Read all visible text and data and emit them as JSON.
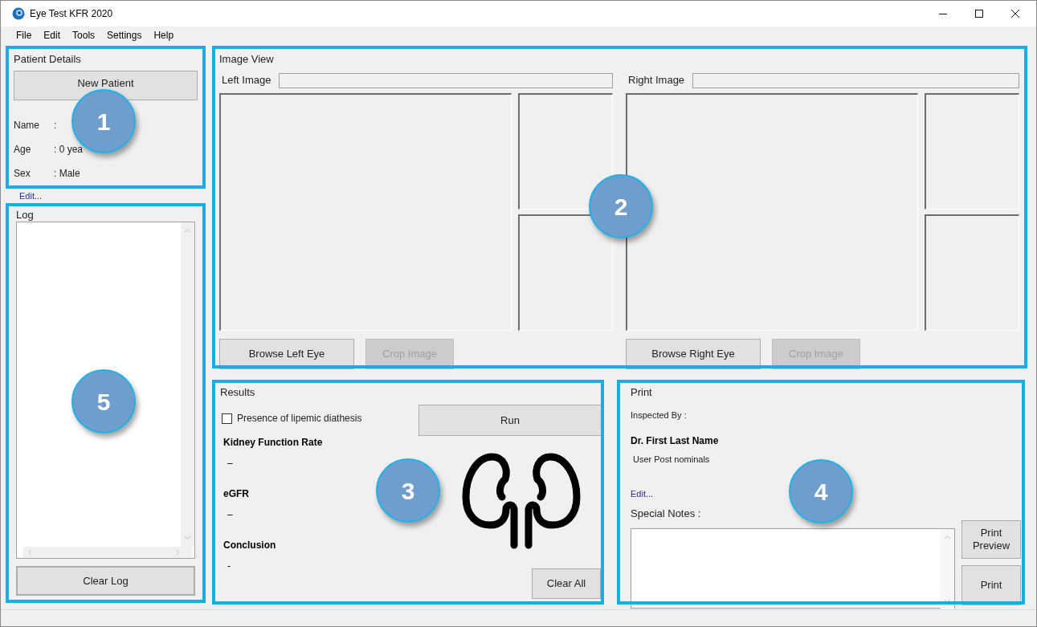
{
  "window": {
    "title": "Eye Test KFR 2020"
  },
  "menu": [
    "File",
    "Edit",
    "Tools",
    "Settings",
    "Help"
  ],
  "patient_details": {
    "title": "Patient Details",
    "callout": "1",
    "new_patient_button": "New Patient",
    "fields": [
      {
        "label": "Name",
        "value": ":"
      },
      {
        "label": "Age",
        "value": ": 0 yea"
      },
      {
        "label": "Sex",
        "value": ": Male"
      }
    ],
    "edit_link": "Edit..."
  },
  "log": {
    "title": "Log",
    "callout": "5",
    "clear_button": "Clear Log"
  },
  "image_view": {
    "title": "Image View",
    "callout": "2",
    "sides": [
      {
        "label": "Left Image",
        "browse_button": "Browse Left Eye",
        "crop_button": {
          "label": "Crop Image",
          "disabled": true
        }
      },
      {
        "label": "Right Image",
        "browse_button": "Browse Right Eye",
        "crop_button": {
          "label": "Crop Image",
          "disabled": true
        }
      }
    ]
  },
  "results": {
    "title": "Results",
    "callout": "3",
    "checkbox": {
      "label": "Presence of lipemic diathesis",
      "checked": false
    },
    "run_button": "Run",
    "metrics": [
      {
        "label": "Kidney Function Rate",
        "value": "–"
      },
      {
        "label": "eGFR",
        "value": "–"
      },
      {
        "label": "Conclusion",
        "value": "-"
      }
    ],
    "clear_button": "Clear All"
  },
  "print": {
    "title": "Print",
    "callout": "4",
    "inspected_by": "Inspected By :",
    "doctor": "Dr. First Last Name",
    "post_nominals": "User Post nominals",
    "edit_link": "Edit...",
    "special_notes_label": "Special Notes :",
    "print_preview_button": "Print Preview",
    "print_button": "Print"
  }
}
